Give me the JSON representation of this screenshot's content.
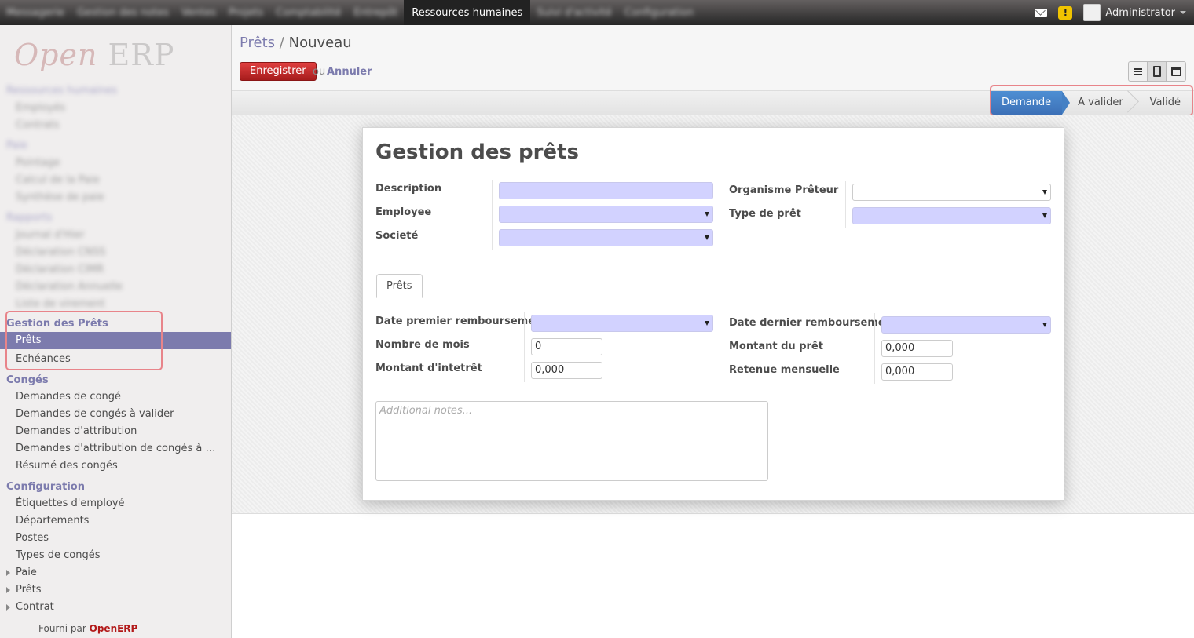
{
  "topbar": {
    "menus": [
      "Messagerie",
      "Gestion des notes",
      "Ventes",
      "Projets",
      "Comptabilité",
      "Entrepôt",
      "Ressources humaines",
      "Suivi d'activité",
      "Configuration"
    ],
    "active_menu": "Ressources humaines",
    "user": "Administrator"
  },
  "sidebar": {
    "logo_open": "Open",
    "logo_erp": "ERP",
    "blurred": [
      "Ressources humaines",
      "Employés",
      "Contrats",
      "Paie",
      "Pointage",
      "Calcul de la Paie",
      "Synthèse de paie",
      "Rapports",
      "Journal d'Hier",
      "Déclaration CNSS",
      "Déclaration CIMR",
      "Déclaration Annuelle",
      "Liste de virement"
    ],
    "gestion_head": "Gestion des Prêts",
    "prets": "Prêts",
    "echeances": "Echéances",
    "conges_head": "Congés",
    "conges_items": [
      "Demandes de congé",
      "Demandes de congés à valider",
      "Demandes d'attribution",
      "Demandes d'attribution de congés à …",
      "Résumé des congés"
    ],
    "config_head": "Configuration",
    "config_items": [
      "Étiquettes d'employé",
      "Départements",
      "Postes",
      "Types de congés"
    ],
    "collapsed": [
      "Paie",
      "Prêts",
      "Contrat"
    ],
    "powered_prefix": "Fourni par",
    "powered_brand": "OpenERP"
  },
  "header": {
    "bc_parent": "Prêts",
    "bc_sep": "/",
    "bc_current": "Nouveau",
    "save_label": "Enregistrer",
    "or_label": "ou",
    "cancel_label": "Annuler"
  },
  "status": {
    "stages": [
      "Demande",
      "A valider",
      "Validé"
    ],
    "current": "Demande"
  },
  "form": {
    "title": "Gestion des prêts",
    "labels": {
      "description": "Description",
      "employee": "Employee",
      "company": "Societé",
      "lender": "Organisme Prêteur",
      "loan_type": "Type de prêt",
      "first_date": "Date premier remboursement",
      "last_date": "Date dernier remboursement",
      "months": "Nombre de mois",
      "amount": "Montant du prêt",
      "interest": "Montant d'intetrêt",
      "monthly": "Retenue mensuelle"
    },
    "tab": "Prêts",
    "values": {
      "months": "0",
      "amount": "0,000",
      "interest": "0,000",
      "monthly": "0,000"
    },
    "notes_placeholder": "Additional notes..."
  }
}
